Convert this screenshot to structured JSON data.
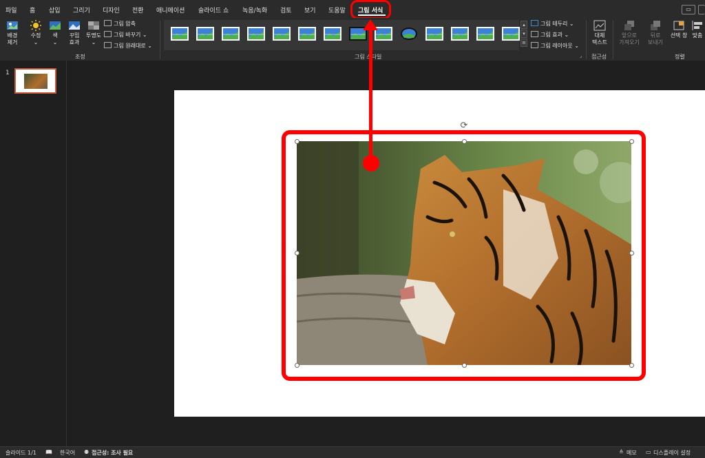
{
  "menu": {
    "tabs": [
      {
        "label": "파일"
      },
      {
        "label": "홈"
      },
      {
        "label": "삽입"
      },
      {
        "label": "그리기"
      },
      {
        "label": "디자인"
      },
      {
        "label": "전환"
      },
      {
        "label": "애니메이션"
      },
      {
        "label": "슬라이드 쇼"
      },
      {
        "label": "녹음/녹화"
      },
      {
        "label": "검토"
      },
      {
        "label": "보기"
      },
      {
        "label": "도움말"
      },
      {
        "label": "그림 서식"
      }
    ],
    "active_index": 12
  },
  "ribbon": {
    "adjust": {
      "remove_bg": "배경\n제거",
      "corrections": "수정",
      "color": "색",
      "artistic": "꾸밈\n효과",
      "transparency": "투명도",
      "compress": "그림 압축",
      "change": "그림 바꾸기",
      "reset": "그림 원래대로",
      "group_label": "조정"
    },
    "styles": {
      "border": "그림 테두리",
      "effects": "그림 효과",
      "layout": "그림 레이아웃",
      "group_label": "그림 스타일"
    },
    "accessibility": {
      "alt_text": "대체\n텍스트",
      "group_label": "접근성"
    },
    "arrange": {
      "bring_forward": "앞으로\n가져오기",
      "send_backward": "뒤로\n보내기",
      "selection_pane": "선택 창",
      "align": "맞춤",
      "group_label": "정렬"
    }
  },
  "thumbnails": {
    "slide_number": "1"
  },
  "status": {
    "slide": "슬라이드 1/1",
    "language": "한국어",
    "accessibility": "접근성: 조사 필요",
    "notes": "메모",
    "display": "디스플레이 설정"
  },
  "colors": {
    "highlight": "#ff0000",
    "active_accent": "#c55a3c",
    "background": "#1f1f1f",
    "ribbon": "#2b2b2b"
  },
  "icons": {
    "rotate": "rotate-handle-icon",
    "comment": "comment-icon"
  }
}
